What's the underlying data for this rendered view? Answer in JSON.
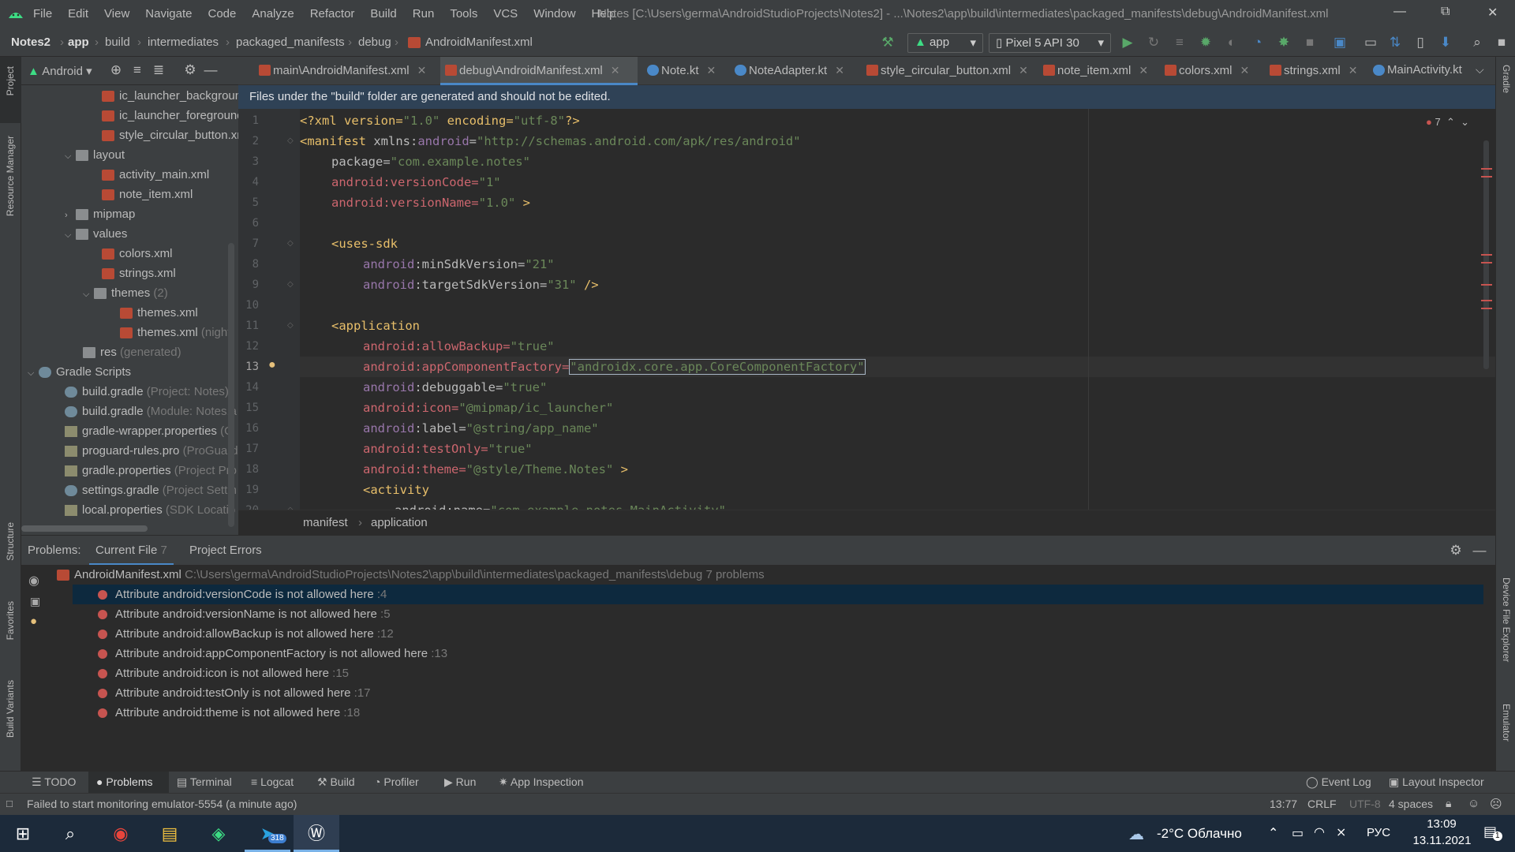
{
  "menu": [
    "File",
    "Edit",
    "View",
    "Navigate",
    "Code",
    "Analyze",
    "Refactor",
    "Build",
    "Run",
    "Tools",
    "VCS",
    "Window",
    "Help"
  ],
  "window_title": "Notes [C:\\Users\\germa\\AndroidStudioProjects\\Notes2] - ...\\Notes2\\app\\build\\intermediates\\packaged_manifests\\debug\\AndroidManifest.xml",
  "breadcrumb": [
    "Notes2",
    "app",
    "build",
    "intermediates",
    "packaged_manifests",
    "debug",
    "AndroidManifest.xml"
  ],
  "run_config": "app",
  "device": "Pixel 5 API 30",
  "project_view": "Android",
  "tree": [
    {
      "label": "ic_launcher_background",
      "dim": ""
    },
    {
      "label": "ic_launcher_foreground",
      "dim": ""
    },
    {
      "label": "style_circular_button.xml",
      "dim": ""
    },
    {
      "label": "layout",
      "dim": ""
    },
    {
      "label": "activity_main.xml",
      "dim": ""
    },
    {
      "label": "note_item.xml",
      "dim": ""
    },
    {
      "label": "mipmap",
      "dim": ""
    },
    {
      "label": "values",
      "dim": ""
    },
    {
      "label": "colors.xml",
      "dim": ""
    },
    {
      "label": "strings.xml",
      "dim": ""
    },
    {
      "label": "themes",
      "dim": "(2)"
    },
    {
      "label": "themes.xml",
      "dim": ""
    },
    {
      "label": "themes.xml",
      "dim": "(night)"
    },
    {
      "label": "res",
      "dim": "(generated)"
    },
    {
      "label": "Gradle Scripts",
      "dim": ""
    },
    {
      "label": "build.gradle",
      "dim": "(Project: Notes)"
    },
    {
      "label": "build.gradle",
      "dim": "(Module: Notes.a"
    },
    {
      "label": "gradle-wrapper.properties",
      "dim": "(G"
    },
    {
      "label": "proguard-rules.pro",
      "dim": "(ProGuard"
    },
    {
      "label": "gradle.properties",
      "dim": "(Project Pro"
    },
    {
      "label": "settings.gradle",
      "dim": "(Project Settin"
    },
    {
      "label": "local.properties",
      "dim": "(SDK Locatio"
    }
  ],
  "tabs": [
    "main\\AndroidManifest.xml",
    "debug\\AndroidManifest.xml",
    "Note.kt",
    "NoteAdapter.kt",
    "style_circular_button.xml",
    "note_item.xml",
    "colors.xml",
    "strings.xml",
    "MainActivity.kt"
  ],
  "banner": "Files under the \"build\" folder are generated and should not be edited.",
  "line_numbers": [
    "1",
    "2",
    "3",
    "4",
    "5",
    "6",
    "7",
    "8",
    "9",
    "10",
    "11",
    "12",
    "13",
    "14",
    "15",
    "16",
    "17",
    "18",
    "19",
    "20"
  ],
  "code": {
    "l1": [
      "<?xml version=",
      "\"1.0\"",
      " encoding=",
      "\"utf-8\"",
      "?>"
    ],
    "l2": [
      "<manifest ",
      "xmlns:",
      "android",
      "=",
      "\"http://schemas.android.com/apk/res/android\""
    ],
    "l3": [
      "package=",
      "\"com.example.notes\""
    ],
    "l4": [
      "android:versionCode=",
      "\"1\""
    ],
    "l5": [
      "android:versionName=",
      "\"1.0\"",
      " >"
    ],
    "l7": [
      "<uses-sdk"
    ],
    "l8": [
      "android",
      ":minSdkVersion=",
      "\"21\""
    ],
    "l9": [
      "android",
      ":targetSdkVersion=",
      "\"31\"",
      " />"
    ],
    "l11": [
      "<application"
    ],
    "l12": [
      "android:allowBackup=",
      "\"true\""
    ],
    "l13": [
      "android:appComponentFactory=",
      "\"androidx.core.app.CoreComponentFactory\""
    ],
    "l14": [
      "android",
      ":debuggable=",
      "\"true\""
    ],
    "l15": [
      "android:icon=",
      "\"@mipmap/ic_launcher\""
    ],
    "l16": [
      "android",
      ":label=",
      "\"@string/app_name\""
    ],
    "l17": [
      "android:testOnly=",
      "\"true\""
    ],
    "l18": [
      "android:theme=",
      "\"@style/Theme.Notes\"",
      " >"
    ],
    "l19": [
      "<activity"
    ],
    "l20": [
      "android:name=",
      "\"com.example.notes.MainActivity\""
    ]
  },
  "error_count": "7",
  "editor_breadcrumb": [
    "manifest",
    "application"
  ],
  "problems": {
    "label": "Problems:",
    "tabs": [
      "Current File",
      "Project Errors"
    ],
    "current_count": "7",
    "file": "AndroidManifest.xml",
    "path": "C:\\Users\\germa\\AndroidStudioProjects\\Notes2\\app\\build\\intermediates\\packaged_manifests\\debug",
    "summary": "7 problems",
    "items": [
      {
        "text": "Attribute android:versionCode is not allowed here",
        "line": ":4"
      },
      {
        "text": "Attribute android:versionName is not allowed here",
        "line": ":5"
      },
      {
        "text": "Attribute android:allowBackup is not allowed here",
        "line": ":12"
      },
      {
        "text": "Attribute android:appComponentFactory is not allowed here",
        "line": ":13"
      },
      {
        "text": "Attribute android:icon is not allowed here",
        "line": ":15"
      },
      {
        "text": "Attribute android:testOnly is not allowed here",
        "line": ":17"
      },
      {
        "text": "Attribute android:theme is not allowed here",
        "line": ":18"
      }
    ]
  },
  "side_left": [
    "Project",
    "Resource Manager",
    "Structure",
    "Favorites",
    "Build Variants"
  ],
  "side_right": [
    "Gradle",
    "Device File Explorer",
    "Emulator"
  ],
  "bottom_tools": [
    "TODO",
    "Problems",
    "Terminal",
    "Logcat",
    "Build",
    "Profiler",
    "Run",
    "App Inspection"
  ],
  "bottom_right": [
    "Event Log",
    "Layout Inspector"
  ],
  "status": {
    "message": "Failed to start monitoring emulator-5554 (a minute ago)",
    "position": "13:77",
    "line_sep": "CRLF",
    "encoding": "UTF-8",
    "indent": "4 spaces"
  },
  "taskbar": {
    "weather": "-2°C Облачно",
    "lang": "РУС",
    "time": "13:09",
    "date": "13.11.2021",
    "telegram_badge": "318",
    "notif_count": "1"
  },
  "colors": {
    "accent": "#4a88c7",
    "error": "#c75450",
    "tag": "#e8bf6a",
    "value": "#6a8759",
    "namespace": "#9876aa",
    "bad_attr": "#cc666e"
  }
}
